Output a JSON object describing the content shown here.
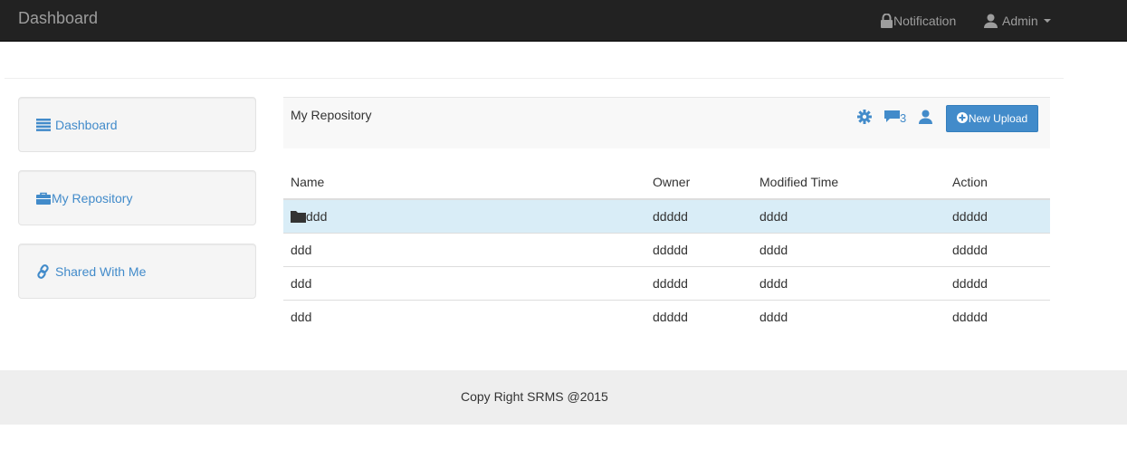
{
  "navbar": {
    "brand": "Dashboard",
    "notification_label": "Notification",
    "admin_label": "Admin"
  },
  "sidebar": {
    "items": [
      {
        "label": "Dashboard",
        "icon": "list-icon"
      },
      {
        "label": "My Repository",
        "icon": "briefcase-icon"
      },
      {
        "label": "Shared With Me",
        "icon": "link-icon"
      }
    ]
  },
  "panel": {
    "title": "My Repository",
    "comment_count": "3",
    "upload_label": "New Upload"
  },
  "table": {
    "columns": [
      "Name",
      "Owner",
      "Modified Time",
      "Action"
    ],
    "rows": [
      {
        "name": "ddd",
        "owner": "ddddd",
        "modified": "dddd",
        "action": "ddddd",
        "folder": true
      },
      {
        "name": "ddd",
        "owner": "ddddd",
        "modified": "dddd",
        "action": "ddddd"
      },
      {
        "name": "ddd",
        "owner": "ddddd",
        "modified": "dddd",
        "action": "ddddd"
      },
      {
        "name": "ddd",
        "owner": "ddddd",
        "modified": "dddd",
        "action": "ddddd"
      }
    ]
  },
  "footer": {
    "text": "Copy Right SRMS @2015"
  },
  "colors": {
    "navbar": "#222222",
    "accent": "#428bca",
    "active_row": "#d9edf7",
    "footer": "#eeeeee"
  }
}
